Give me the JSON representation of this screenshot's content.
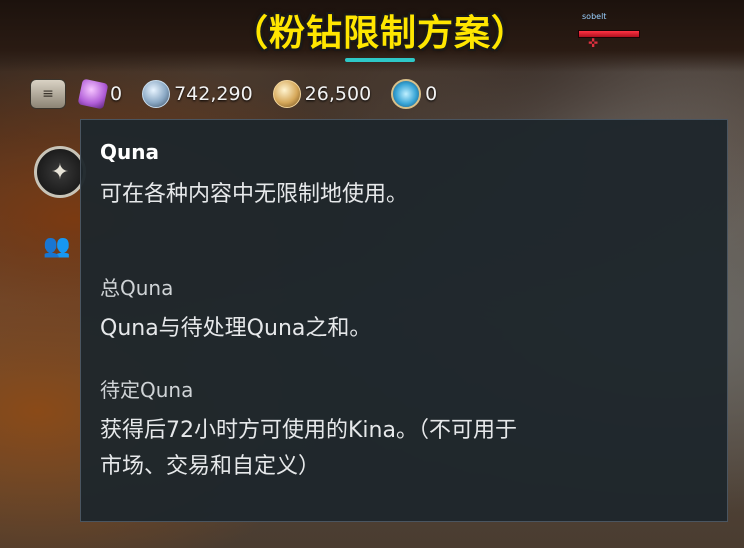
{
  "overlay": {
    "headline": "（粉钻限制方案）",
    "player_tag": "sobelt"
  },
  "currencies": [
    {
      "icon": "resource-stack-icon",
      "value": ""
    },
    {
      "icon": "pink-gem-icon",
      "value": "0"
    },
    {
      "icon": "quna-coin-icon",
      "value": "742,290"
    },
    {
      "icon": "kina-coin-icon",
      "value": "26,500"
    },
    {
      "icon": "blue-medal-icon",
      "value": "0"
    }
  ],
  "tooltip": {
    "title": "Quna",
    "description": "可在各种内容中无限制地使用。",
    "total_label": "总Quna",
    "total_desc": "Quna与待处理Quna之和。",
    "pending_label": "待定Quna",
    "pending_desc_line1": "获得后72小时方可使用的Kina。（不可用于",
    "pending_desc_line2": "市场、交易和自定义）"
  },
  "colors": {
    "headline": "#ffe600",
    "tooltip_bg": "#1e262c",
    "hp": "#e0303e",
    "accent_teal": "#2ec8c8"
  }
}
